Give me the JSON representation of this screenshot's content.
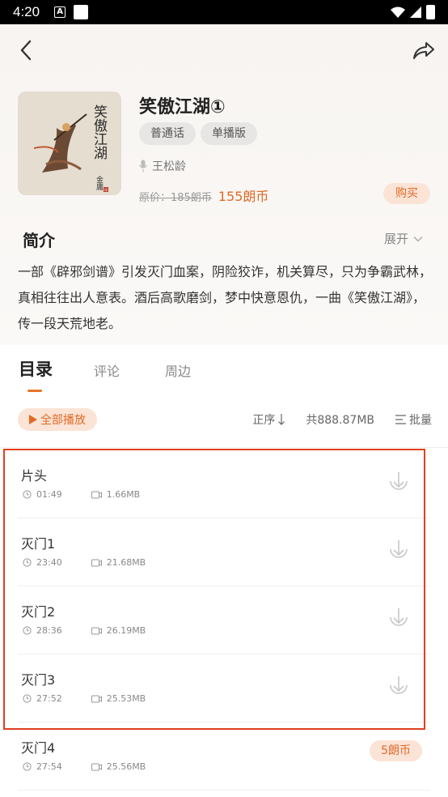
{
  "status_bar": {
    "time": "4:20"
  },
  "header": {
    "title": "笑傲江湖①",
    "tags": [
      "普通话",
      "单播版"
    ],
    "author": "王松龄",
    "original_price": "原价：185朗币",
    "price": "155朗币",
    "buy_label": "购买",
    "cover_calligraphy": "笑傲江湖",
    "cover_signature": "金庸",
    "cover_seal": "印",
    "accent_color": "#e06a25"
  },
  "intro": {
    "title": "简介",
    "expand_label": "展开",
    "text": "一部《辟邪剑谱》引发灭门血案，阴险狡诈，机关算尽，只为争霸武林，真相往往出人意表。酒后高歌磨剑，梦中快意恩仇，一曲《笑傲江湖》，传一段天荒地老。"
  },
  "tabs": [
    {
      "label": "目录",
      "active": true
    },
    {
      "label": "评论",
      "active": false
    },
    {
      "label": "周边",
      "active": false
    }
  ],
  "toolbar": {
    "play_all": "全部播放",
    "sort": "正序",
    "total_size": "共888.87MB",
    "batch": "批量"
  },
  "episodes": [
    {
      "title": "片头",
      "duration": "01:49",
      "size": "1.66MB"
    },
    {
      "title": "灭门1",
      "duration": "23:40",
      "size": "21.68MB"
    },
    {
      "title": "灭门2",
      "duration": "28:36",
      "size": "26.19MB"
    },
    {
      "title": "灭门3",
      "duration": "27:52",
      "size": "25.53MB"
    },
    {
      "title": "灭门4",
      "duration": "27:54",
      "size": "25.56MB",
      "price": "5朗币"
    }
  ]
}
